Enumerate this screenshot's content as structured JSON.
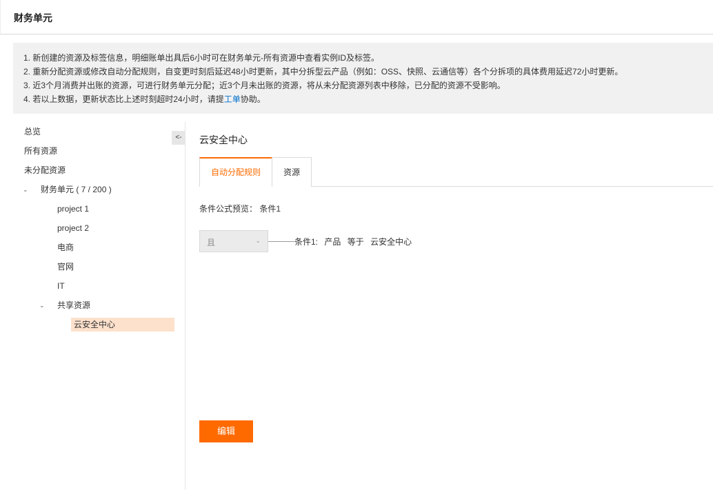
{
  "header": {
    "title": "财务单元"
  },
  "notice": {
    "lines": [
      "1. 新创建的资源及标签信息，明细账单出具后6小时可在财务单元-所有资源中查看实例ID及标签。",
      "2. 重新分配资源或修改自动分配规则，自变更时刻后延迟48小时更新，其中分拆型云产品（例如：OSS、快照、云通信等）各个分拆项的具体费用延迟72小时更新。",
      "3. 近3个月消费并出账的资源，可进行财务单元分配；近3个月未出账的资源，将从未分配资源列表中移除，已分配的资源不受影响。"
    ],
    "line4_prefix": "4. 若以上数据，更新状态比上述时刻超时24小时，请提",
    "line4_link": "工单",
    "line4_suffix": "协助。"
  },
  "sidebar": {
    "collapse_label": "<-",
    "items": {
      "overview": "总览",
      "all_resources": "所有资源",
      "unallocated": "未分配资源",
      "finance_unit": "财务单元 ( 7 / 200 )",
      "project1": "project 1",
      "project2": "project 2",
      "ecommerce": "电商",
      "website": "官网",
      "it": "IT",
      "shared": "共享资源",
      "cloud_security": "云安全中心"
    }
  },
  "main": {
    "title": "云安全中心",
    "tabs": {
      "auto_rules": "自动分配规则",
      "resources": "资源"
    },
    "formula_label": "条件公式预览：",
    "formula_value": "条件1",
    "select_value": "且",
    "condition": {
      "name": "条件1:",
      "field": "产品",
      "operator": "等于",
      "value": "云安全中心"
    },
    "edit_label": "编辑"
  },
  "colors": {
    "accent": "#ff6a00",
    "active_bg": "#fde1cc",
    "link": "#0070cc"
  }
}
